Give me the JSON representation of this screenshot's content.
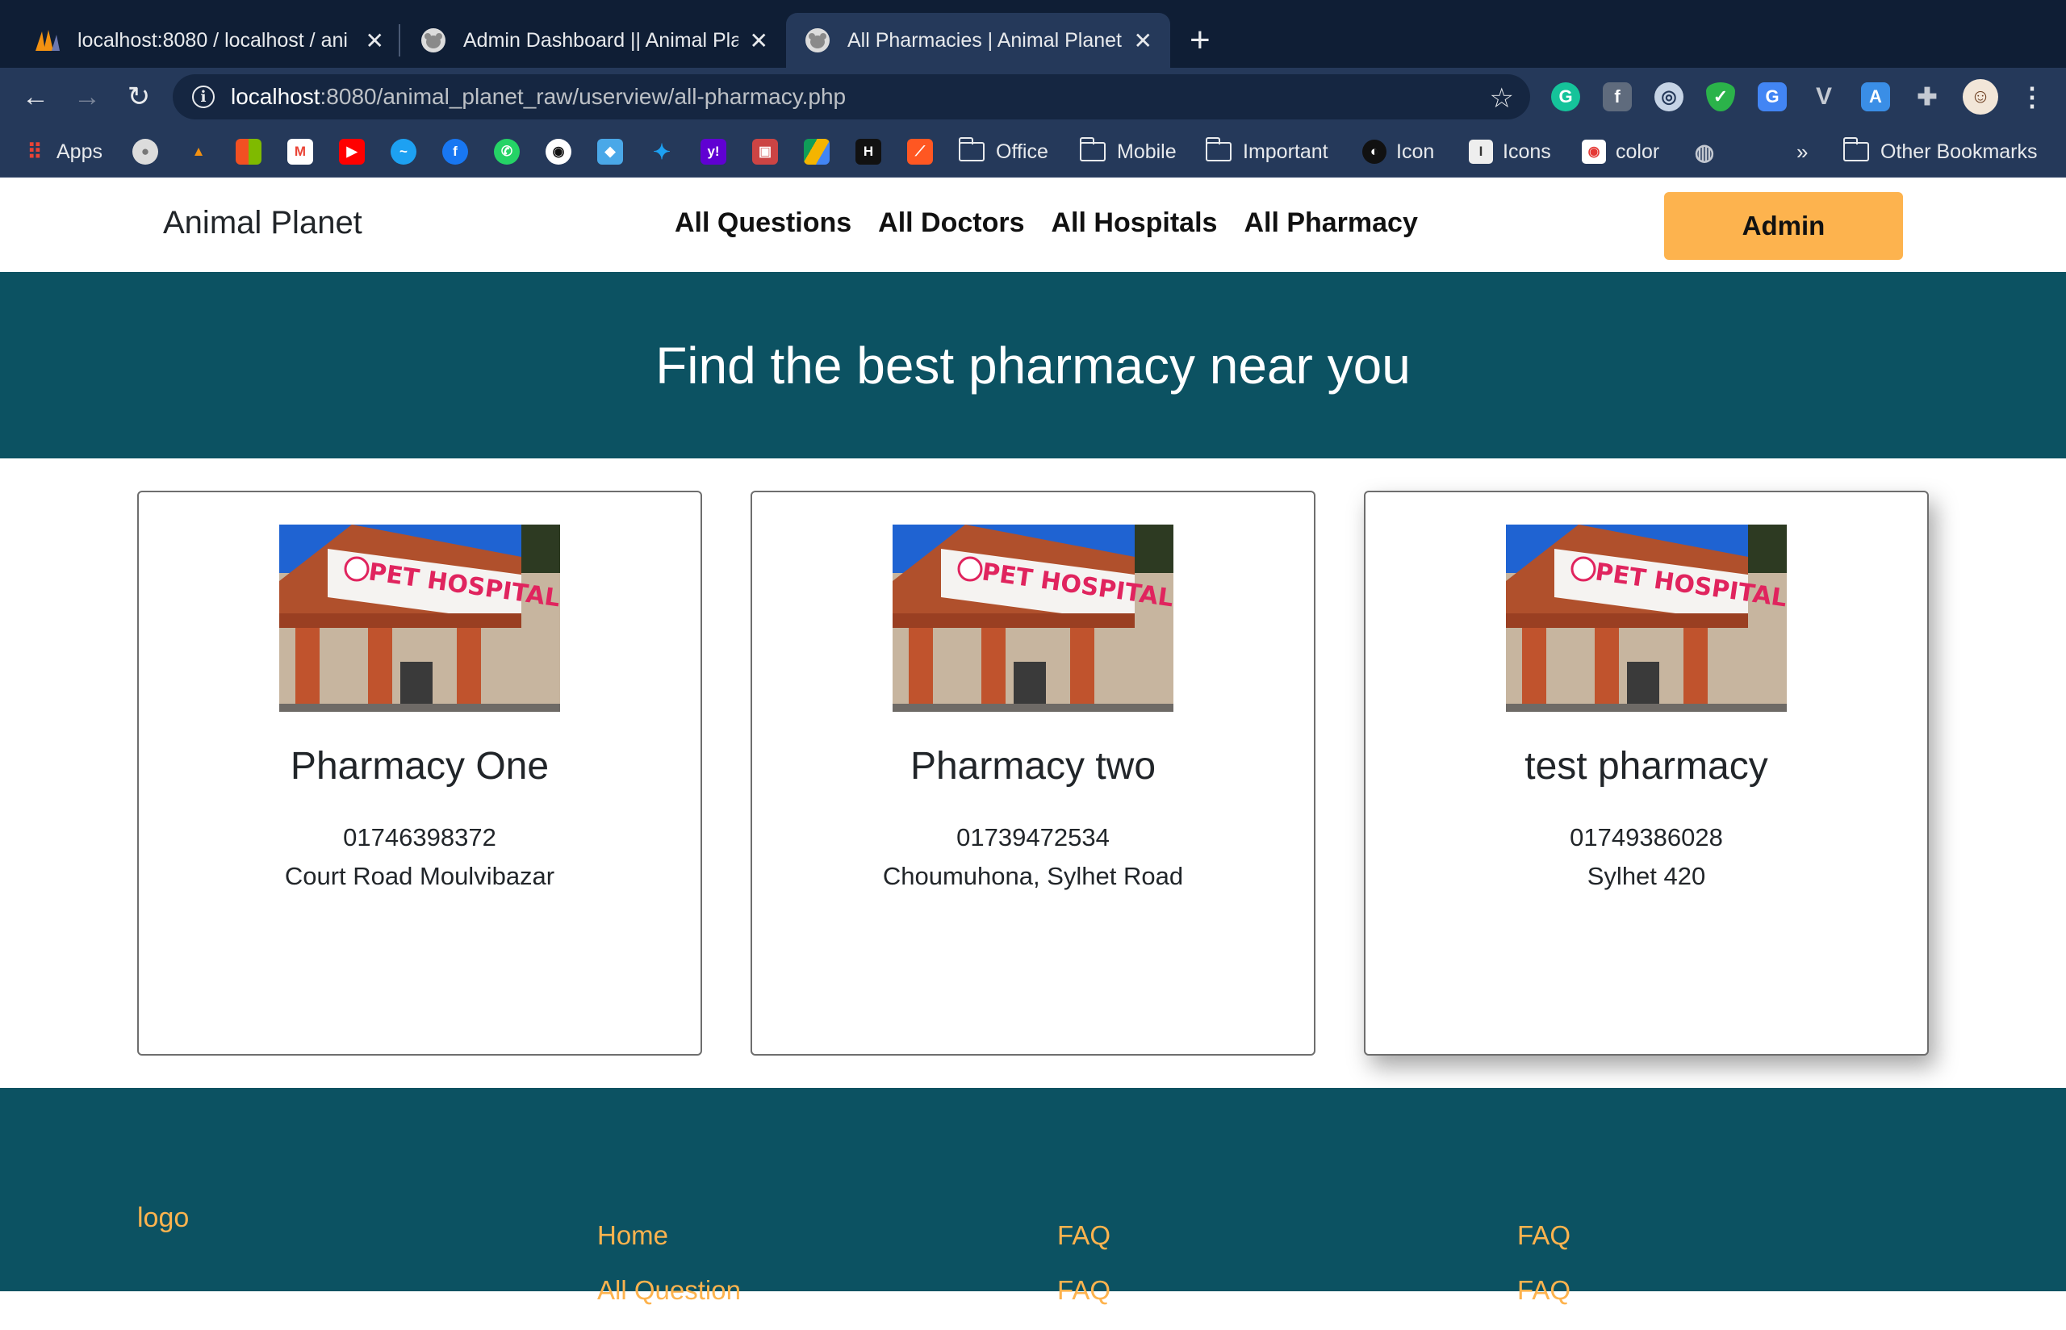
{
  "browser": {
    "tabs": [
      {
        "title": "localhost:8080 / localhost / ani",
        "icon": "phpmyadmin-icon",
        "active": false
      },
      {
        "title": "Admin Dashboard || Animal Pla",
        "icon": "animal-planet-icon",
        "active": false
      },
      {
        "title": "All Pharmacies | Animal Planet",
        "icon": "animal-planet-icon",
        "active": true
      }
    ],
    "url_host": "localhost",
    "url_rest": ":8080/animal_planet_raw/userview/all-pharmacy.php",
    "bookmarks": {
      "apps": "Apps",
      "office": "Office",
      "mobile": "Mobile",
      "important": "Important",
      "icon": "Icon",
      "icons": "Icons",
      "color": "color",
      "overflow": "»",
      "other": "Other Bookmarks"
    }
  },
  "navbar": {
    "brand": "Animal Planet",
    "links": [
      "All Questions",
      "All Doctors",
      "All Hospitals",
      "All Pharmacy"
    ],
    "admin_label": "Admin"
  },
  "hero": {
    "title": "Find the best pharmacy near you"
  },
  "pharmacies": [
    {
      "name": "Pharmacy One",
      "phone": "01746398372",
      "address": "Court Road Moulvibazar",
      "image_sign": "PET HOSPITAL"
    },
    {
      "name": "Pharmacy two",
      "phone": "01739472534",
      "address": "Choumuhona, Sylhet Road",
      "image_sign": "PET HOSPITAL"
    },
    {
      "name": "test pharmacy",
      "phone": "01749386028",
      "address": "Sylhet 420",
      "image_sign": "PET HOSPITAL"
    }
  ],
  "footer": {
    "logo": "logo",
    "col1": [
      "Home",
      "All Question"
    ],
    "col2": [
      "FAQ",
      "FAQ"
    ],
    "col3": [
      "FAQ",
      "FAQ"
    ]
  },
  "colors": {
    "accent": "#fdb34e",
    "teal": "#0c5262",
    "chrome_dark": "#0f1e35",
    "chrome": "#25395a"
  }
}
